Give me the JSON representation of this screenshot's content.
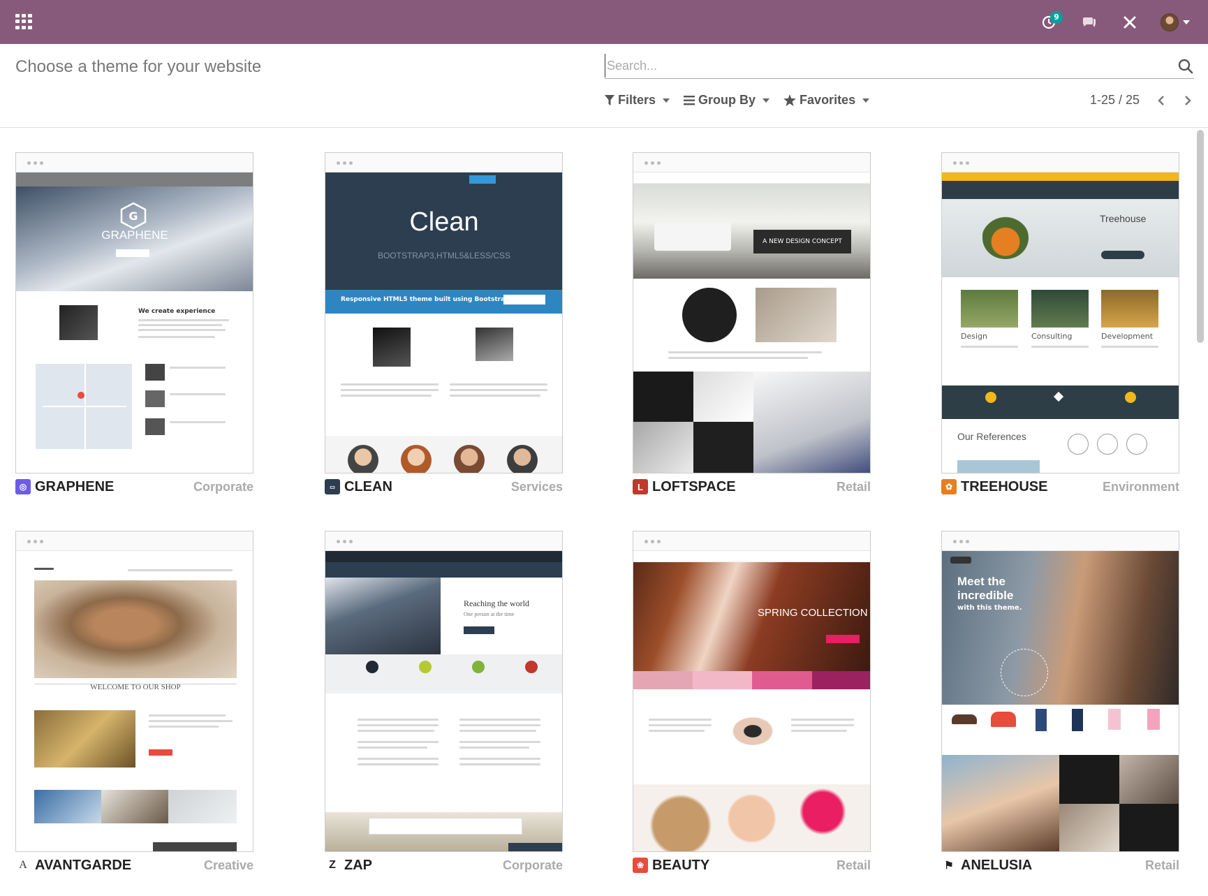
{
  "page": {
    "title": "Choose a theme for your website"
  },
  "navbar": {
    "activity_count": "9"
  },
  "search": {
    "placeholder": "Search..."
  },
  "filters": {
    "filters_label": "Filters",
    "groupby_label": "Group By",
    "favorites_label": "Favorites"
  },
  "pager": {
    "value": "1-25 / 25"
  },
  "themes": [
    {
      "name": "GRAPHENE",
      "category": "Corporate",
      "preview_headline": "GRAPHENE",
      "preview_sub": "We create experience"
    },
    {
      "name": "CLEAN",
      "category": "Services",
      "preview_headline": "Clean",
      "preview_sub": "BOOTSTRAP3,HTML5&LESS/CSS",
      "preview_banner": "Responsive HTML5 theme built using Bootstrap"
    },
    {
      "name": "LOFTSPACE",
      "category": "Retail",
      "preview_headline": "A NEW DESIGN CONCEPT"
    },
    {
      "name": "TREEHOUSE",
      "category": "Environment",
      "preview_headline": "Treehouse",
      "preview_cols": [
        "Design",
        "Consulting",
        "Development"
      ],
      "preview_refs": "Our References"
    },
    {
      "name": "AVANTGARDE",
      "category": "Creative",
      "preview_headline": "WELCOME TO OUR SHOP"
    },
    {
      "name": "ZAP",
      "category": "Corporate",
      "preview_headline": "Reaching the world",
      "preview_sub": "One person at the time"
    },
    {
      "name": "BEAUTY",
      "category": "Retail",
      "preview_headline": "SPRING COLLECTION"
    },
    {
      "name": "ANELUSIA",
      "category": "Retail",
      "preview_headline": "Meet the incredible",
      "preview_sub": "with this theme."
    }
  ],
  "colors": {
    "navbar": "#875a7b",
    "badge": "#00a09d"
  }
}
